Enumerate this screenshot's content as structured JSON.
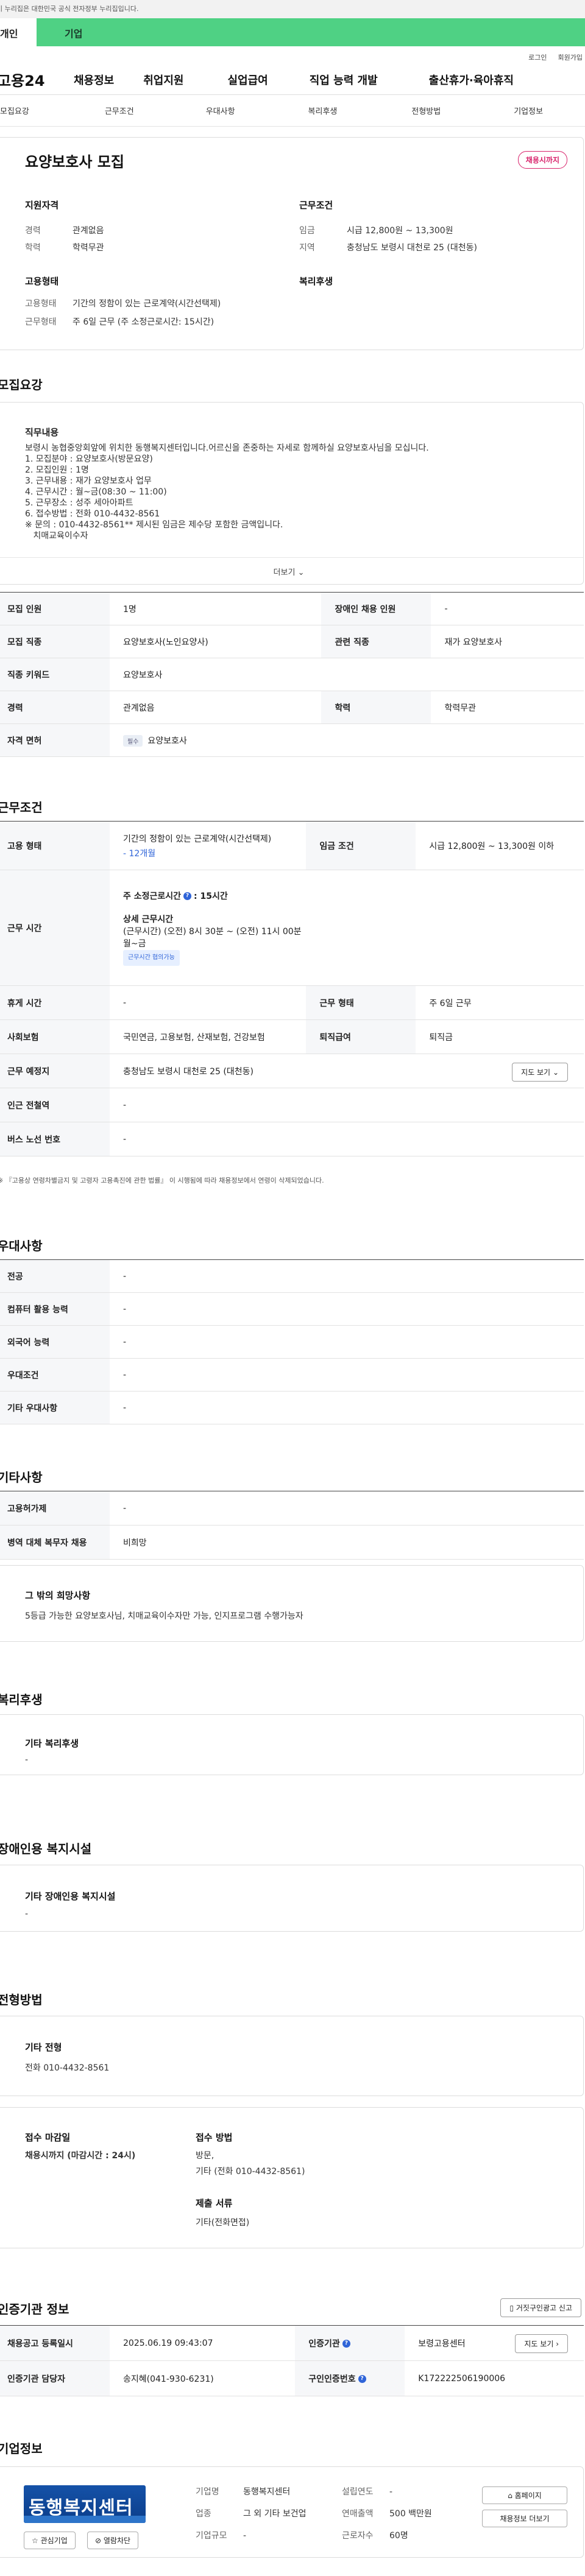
{
  "gov_banner": "이 누리집은 대한민국 공식 전자정부 누리집입니다.",
  "user_tabs": [
    "개인",
    "기업"
  ],
  "util": [
    "로그인",
    "회원가입"
  ],
  "logo": "고용24",
  "gnb": [
    "채용정보",
    "취업지원",
    "실업급여",
    "직업 능력 개발",
    "출산휴가·육아휴직"
  ],
  "anchors": [
    "모집요강",
    "근무조건",
    "우대사항",
    "복리후생",
    "전형방법",
    "기업정보"
  ],
  "summary": {
    "title": "요양보호사 모집",
    "badge": "채용시까지",
    "qual_label": "지원자격",
    "qual": [
      {
        "k": "경력",
        "v": "관계없음"
      },
      {
        "k": "학력",
        "v": "학력무관"
      }
    ],
    "cond_label": "근무조건",
    "cond": [
      {
        "k": "임금",
        "v": "시급 12,800원 ~ 13,300원"
      },
      {
        "k": "지역",
        "v": "충청남도 보령시 대천로 25 (대천동)"
      }
    ],
    "emp_label": "고용형태",
    "emp": [
      {
        "k": "고용형태",
        "v": "기간의 정함이 있는 근로계약(시간선택제)"
      },
      {
        "k": "근무형태",
        "v": "주 6일 근무 (주 소정근로시간: 15시간)"
      }
    ],
    "welfare_label": "복리후생"
  },
  "recruit": {
    "section": "모집요강",
    "head": "직무내용",
    "body": "보령시 농협중앙회앞에 위치한 동행복지센터입니다.어르신을 존중하는 자세로 함께하실 요양보호사님을 모십니다.\n1. 모집분야 : 요양보호사(방문요양)\n2. 모집인원 : 1명\n3. 근무내용 : 재가 요양보호사 업무\n4. 근무시간 : 월~금(08:30 ~ 11:00)\n5. 근무장소 : 성주 세아아파트\n6. 접수방법 : 전화 010-4432-8561\n※ 문의 : 010-4432-8561** 제시된 임금은 제수당 포함한 금액입니다.\n   치매교육이수자",
    "more": "더보기",
    "rows": [
      {
        "k": "모집 인원",
        "v": "1명",
        "k2": "장애인 채용 인원",
        "v2": "-"
      },
      {
        "k": "모집 직종",
        "v": "요양보호사(노인요양사)",
        "k2": "관련 직종",
        "v2": "재가 요양보호사"
      },
      {
        "k": "직종 키워드",
        "v": "요양보호사"
      },
      {
        "k": "경력",
        "v": "관계없음",
        "k2": "학력",
        "v2": "학력무관"
      },
      {
        "k": "자격 면허",
        "tag": "필수",
        "v": "요양보호사"
      }
    ]
  },
  "work": {
    "section": "근무조건",
    "emp_k": "고용 형태",
    "emp_v": "기간의 정함이 있는 근로계약(시간선택제)",
    "emp_v2": "- 12개월",
    "wage_k": "임금 조건",
    "wage_v": "시급 12,800원 ~ 13,300원 이하",
    "time_k": "근무 시간",
    "time_h1": "주 소정근로시간",
    "time_h1v": ": 15시간",
    "time_h2": "상세 근무시간",
    "time_d1": "(근무시간) (오전) 8시 30분 ~ (오전) 11시 00분",
    "time_d2": "월~금",
    "time_tag": "근무시간 협의가능",
    "rows": [
      {
        "k": "휴게 시간",
        "v": "-",
        "k2": "근무 형태",
        "v2": "주 6일 근무"
      },
      {
        "k": "사회보험",
        "v": "국민연금, 고용보험, 산재보험, 건강보험",
        "k2": "퇴직급여",
        "v2": "퇴직금"
      },
      {
        "k": "근무 예정지",
        "v": "충청남도 보령시 대천로 25 (대천동)",
        "btn": "지도 보기"
      },
      {
        "k": "인근 전철역",
        "v": "-"
      },
      {
        "k": "버스 노선 번호",
        "v": "-"
      }
    ],
    "note": "※ 『고용상 연령차별금지 및 고령자 고용촉진에 관한 법률』 이 시행됨에 따라 채용정보에서 연령이 삭제되었습니다."
  },
  "prefer": {
    "section": "우대사항",
    "rows": [
      {
        "k": "전공",
        "v": "-"
      },
      {
        "k": "컴퓨터 활용 능력",
        "v": "-"
      },
      {
        "k": "외국어 능력",
        "v": "-"
      },
      {
        "k": "우대조건",
        "v": "-"
      },
      {
        "k": "기타 우대사항",
        "v": "-"
      }
    ]
  },
  "etc": {
    "section": "기타사항",
    "rows": [
      {
        "k": "고용허가제",
        "v": "-"
      },
      {
        "k": "병역 대체 복무자 채용",
        "v": "비희망"
      }
    ],
    "hope_h": "그 밖의 희망사항",
    "hope_t": "5등급 가능한 요양보호사님, 치매교육이수자만 가능, 인지프로그램 수행가능자"
  },
  "welfare": {
    "section": "복리후생",
    "h": "기타 복리후생",
    "t": "-"
  },
  "disabled": {
    "section": "장애인용 복지시설",
    "h": "기타 장애인용 복지시설",
    "t": "-"
  },
  "process": {
    "section": "전형방법",
    "h": "기타 전형",
    "t": "전화 010-4432-8561",
    "deadline_h": "접수 마감일",
    "deadline_v": "채용시까지 (마감시간 : 24시)",
    "method_h": "접수 방법",
    "method_1": "방문,",
    "method_2": "기타 (전화 010-4432-8561)",
    "docs_h": "제출 서류",
    "docs_v": "기타(전화면접)"
  },
  "agency": {
    "section": "인증기관 정보",
    "btn": "거짓구인광고 신고",
    "r1k": "채용공고 등록일시",
    "r1v": "2025.06.19 09:43:07",
    "r1k2": "인증기관",
    "r1v2": "보령고용센터",
    "r1btn": "지도 보기",
    "r2k": "인증기관 담당자",
    "r2v": "송지혜(041-930-6231)",
    "r2k2": "구인인증번호",
    "r2v2": "K172222506190006"
  },
  "company": {
    "section": "기업정보",
    "logo_text": "동행복지센터",
    "fields": [
      {
        "k": "기업명",
        "v": "동행복지센터"
      },
      {
        "k": "설립연도",
        "v": "-"
      },
      {
        "k": "업종",
        "v": "그 외 기타 보건업"
      },
      {
        "k": "연매출액",
        "v": "500 백만원"
      },
      {
        "k": "기업규모",
        "v": "-"
      },
      {
        "k": "근로자수",
        "v": "60명"
      }
    ],
    "btn_home": "홈페이지",
    "btn_jobs": "채용정보 더보기",
    "btn_fav": "관심기업",
    "btn_block": "열람차단"
  }
}
